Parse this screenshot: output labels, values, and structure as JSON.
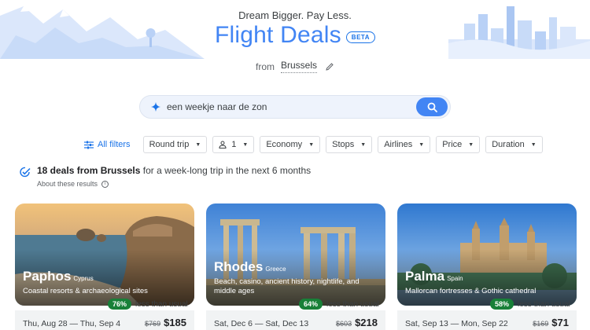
{
  "header": {
    "tagline": "Dream Bigger. Pay Less.",
    "title": "Flight Deals",
    "beta": "BETA",
    "from_label": "from",
    "from_city": "Brussels"
  },
  "search": {
    "value": "een weekje naar de zon",
    "icon": "search-icon"
  },
  "filters": {
    "all": "All filters",
    "chips": {
      "trip": "Round trip",
      "passengers": "1",
      "cabin": "Economy",
      "stops": "Stops",
      "airlines": "Airlines",
      "price": "Price",
      "duration": "Duration"
    }
  },
  "summary": {
    "count_text": "18 deals from Brussels",
    "rest_text": " for a week-long trip in the next 6 months",
    "about": "About these results"
  },
  "colors": {
    "accent": "#4285f4",
    "deal_green": "#188038"
  },
  "cards": [
    {
      "city": "Paphos",
      "country": "Cyprus",
      "description": "Coastal resorts & archaeological sites",
      "percent": "76%",
      "less": "less than usual",
      "dates": "Thu, Aug 28 — Thu, Sep 4",
      "old_price": "$769",
      "price": "$185"
    },
    {
      "city": "Rhodes",
      "country": "Greece",
      "description": "Beach, casino, ancient history, nightlife, and middle ages",
      "percent": "64%",
      "less": "less than usual",
      "dates": "Sat, Dec 6 — Sat, Dec 13",
      "old_price": "$603",
      "price": "$218"
    },
    {
      "city": "Palma",
      "country": "Spain",
      "description": "Mallorcan fortresses & Gothic cathedral",
      "percent": "58%",
      "less": "less than usual",
      "dates": "Sat, Sep 13 — Mon, Sep 22",
      "old_price": "$169",
      "price": "$71"
    }
  ]
}
